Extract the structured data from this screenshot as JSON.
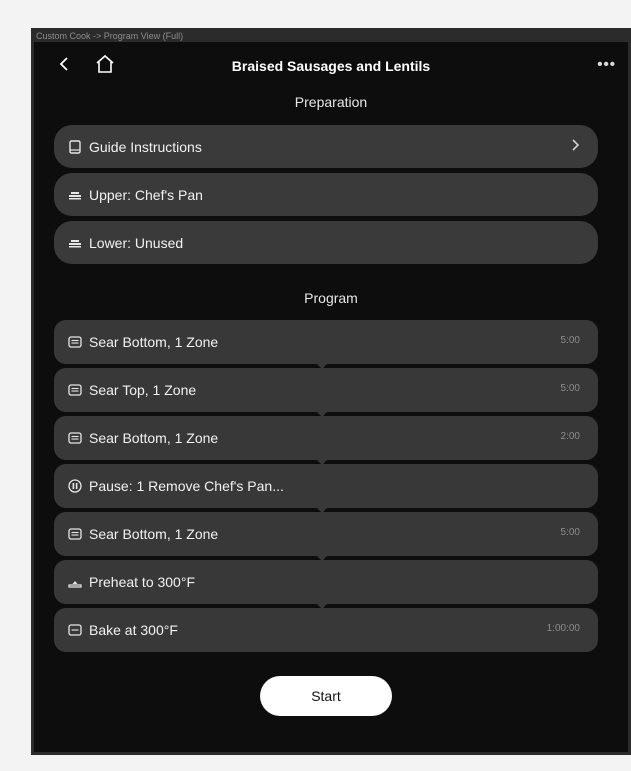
{
  "window_label": "Custom Cook -> Program View (Full)",
  "header": {
    "title": "Braised Sausages and Lentils",
    "more_label": "•••"
  },
  "preparation": {
    "heading": "Preparation",
    "items": [
      {
        "icon": "book-icon",
        "label": "Guide Instructions",
        "has_chevron": true
      },
      {
        "icon": "rack-icon",
        "label": "Upper: Chef's Pan"
      },
      {
        "icon": "rack-icon",
        "label": "Lower: Unused"
      }
    ]
  },
  "program": {
    "heading": "Program",
    "steps": [
      {
        "icon": "broil-icon",
        "label": "Sear Bottom, 1 Zone",
        "time": "5:00"
      },
      {
        "icon": "broil-icon",
        "label": "Sear Top, 1 Zone",
        "time": "5:00"
      },
      {
        "icon": "broil-icon",
        "label": "Sear Bottom, 1 Zone",
        "time": "2:00"
      },
      {
        "icon": "pause-icon",
        "label": "Pause: 1 Remove Chef's Pan...",
        "time": ""
      },
      {
        "icon": "broil-icon",
        "label": "Sear Bottom, 1 Zone",
        "time": "5:00"
      },
      {
        "icon": "preheat-icon",
        "label": "Preheat to 300°F",
        "time": ""
      },
      {
        "icon": "bake-icon",
        "label": "Bake at 300°F",
        "time": "1:00:00"
      }
    ]
  },
  "start_label": "Start"
}
